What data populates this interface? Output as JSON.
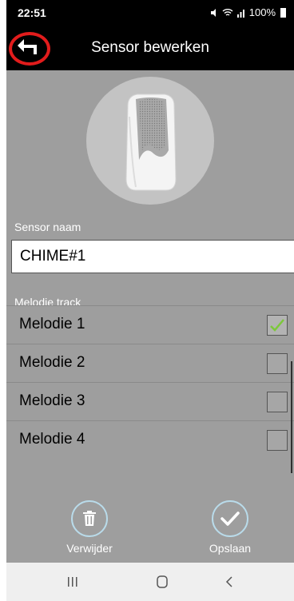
{
  "status": {
    "time": "22:51",
    "battery": "100%"
  },
  "app_bar": {
    "title": "Sensor bewerken"
  },
  "name_section": {
    "label": "Sensor naam",
    "value": "CHIME#1"
  },
  "tracks": {
    "label": "Melodie track",
    "items": [
      {
        "label": "Melodie 1",
        "checked": true
      },
      {
        "label": "Melodie 2",
        "checked": false
      },
      {
        "label": "Melodie 3",
        "checked": false
      },
      {
        "label": "Melodie 4",
        "checked": false
      }
    ]
  },
  "actions": {
    "delete_label": "Verwijder",
    "save_label": "Opslaan"
  },
  "colors": {
    "highlight_ring": "#e21c1c",
    "check_green": "#7cc83a",
    "action_ring": "#b9dbea",
    "panel_gray": "#9e9e9e"
  },
  "icons": {
    "back": "arrow-back-icon",
    "delete": "trash-icon",
    "save": "checkmark-icon",
    "nav_recents": "recents-icon",
    "nav_home": "home-icon",
    "nav_back": "nav-back-icon"
  }
}
